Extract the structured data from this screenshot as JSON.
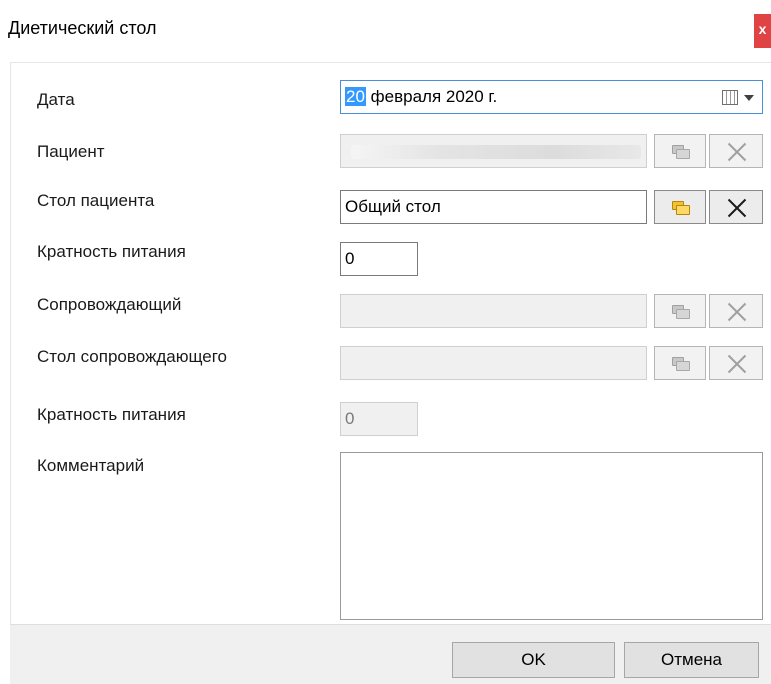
{
  "window": {
    "title": "Диетический стол",
    "close_glyph": "x"
  },
  "form": {
    "date": {
      "label": "Дата",
      "day": "20",
      "rest": " февраля  2020 г."
    },
    "patient": {
      "label": "Пациент"
    },
    "patient_table": {
      "label": "Стол пациента",
      "value": "Общий стол"
    },
    "meal_freq": {
      "label": "Кратность питания",
      "value": "0"
    },
    "companion": {
      "label": "Сопровождающий"
    },
    "companion_table": {
      "label": "Стол сопровождающего"
    },
    "companion_meal_freq": {
      "label": "Кратность питания",
      "value": "0"
    },
    "comment": {
      "label": "Комментарий"
    }
  },
  "footer": {
    "ok_label": "OK",
    "cancel_label": "Отмена"
  },
  "icons": {
    "calendar": "calendar-icon",
    "dropdown": "chevron-down-icon",
    "folder": "folder-icon",
    "clear": "close-icon"
  },
  "colors": {
    "close_button": "#e04343",
    "selection": "#3399ff",
    "folder_active": "#f1c232"
  }
}
